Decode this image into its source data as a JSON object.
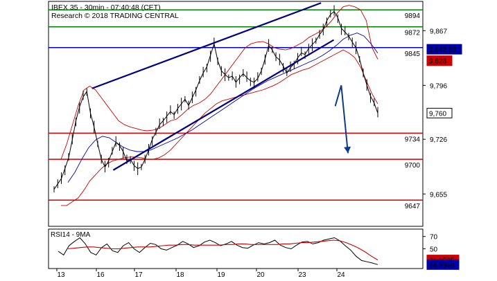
{
  "header": {
    "title": "IBEX 35 - 30min - 07:40:48 (CET)",
    "subtitle": "Research © 2018 TRADING CENTRAL"
  },
  "rsi": {
    "label": "RSI14 - 9MA"
  },
  "colors": {
    "price": "#000000",
    "bollinger": "#cc0000",
    "ma": "#0000aa",
    "trend": "#000080",
    "resistance_green": "#008000",
    "pivot_blue": "#0000cc",
    "support_red": "#cc0000",
    "projection": "#0a3a8a",
    "rsi": "#000000",
    "rsi_ma": "#cc0000",
    "rsi_value_box": "#cc0000",
    "rsi_ma_box": "#0000aa",
    "current_box": "#ffffff",
    "pivot_box": "#0000aa",
    "lower_box": "#cc0000"
  },
  "chart_data": [
    {
      "type": "line",
      "title": "IBEX 35 - 30min - 07:40:48 (CET)",
      "x_tick_labels": [
        "13",
        "16",
        "17",
        "18",
        "19",
        "20",
        "23",
        "24"
      ],
      "y_tick_labels": [
        "9,867",
        "9,796",
        "9,726",
        "9,655"
      ],
      "ylim": [
        9613,
        9905
      ],
      "grid": false,
      "close": [
        9661,
        9668,
        9675,
        9688,
        9702,
        9725,
        9750,
        9768,
        9781,
        9788,
        9760,
        9742,
        9720,
        9700,
        9690,
        9698,
        9710,
        9722,
        9718,
        9710,
        9698,
        9700,
        9692,
        9688,
        9690,
        9700,
        9712,
        9726,
        9735,
        9745,
        9750,
        9756,
        9762,
        9758,
        9766,
        9772,
        9778,
        9770,
        9780,
        9790,
        9802,
        9812,
        9820,
        9835,
        9850,
        9828,
        9815,
        9810,
        9806,
        9808,
        9800,
        9806,
        9811,
        9806,
        9802,
        9800,
        9805,
        9815,
        9830,
        9848,
        9842,
        9833,
        9829,
        9821,
        9812,
        9819,
        9824,
        9832,
        9838,
        9836,
        9844,
        9849,
        9854,
        9862,
        9868,
        9880,
        9888,
        9892,
        9884,
        9870,
        9865,
        9860,
        9852,
        9845,
        9830,
        9812,
        9796,
        9782,
        9773,
        9760
      ],
      "bollinger_upper": [
        9700,
        9720,
        9745,
        9770,
        9790,
        9795,
        9790,
        9780,
        9770,
        9760,
        9750,
        9745,
        9742,
        9740,
        9738,
        9737,
        9738,
        9740,
        9745,
        9750,
        9752,
        9758,
        9765,
        9770,
        9773,
        9778,
        9785,
        9795,
        9805,
        9815,
        9825,
        9835,
        9845,
        9850,
        9852,
        9853,
        9850,
        9845,
        9843,
        9842,
        9844,
        9848,
        9852,
        9858,
        9862,
        9866,
        9872,
        9880,
        9890,
        9898,
        9900,
        9898,
        9894,
        9880,
        9845,
        9830
      ],
      "bollinger_lower": [
        9640,
        9640,
        9645,
        9650,
        9660,
        9672,
        9680,
        9688,
        9694,
        9698,
        9700,
        9702,
        9703,
        9703,
        9702,
        9700,
        9700,
        9702,
        9706,
        9712,
        9720,
        9728,
        9736,
        9744,
        9752,
        9760,
        9766,
        9772,
        9776,
        9778,
        9780,
        9782,
        9784,
        9786,
        9788,
        9790,
        9793,
        9796,
        9800,
        9805,
        9810,
        9813,
        9816,
        9818,
        9822,
        9826,
        9830,
        9834,
        9838,
        9842,
        9838,
        9832,
        9820,
        9802,
        9785,
        9772
      ],
      "moving_average": [
        9670,
        9683,
        9700,
        9715,
        9725,
        9730,
        9728,
        9722,
        9716,
        9712,
        9710,
        9710,
        9712,
        9716,
        9720,
        9724,
        9728,
        9733,
        9738,
        9744,
        9750,
        9756,
        9762,
        9768,
        9774,
        9780,
        9786,
        9792,
        9797,
        9802,
        9806,
        9810,
        9814,
        9818,
        9822,
        9826,
        9830,
        9835,
        9841,
        9848,
        9856,
        9861,
        9864,
        9860,
        9850,
        9838
      ],
      "trendline_upper": [
        [
          0.116,
          9792
        ],
        [
          0.728,
          9903
        ]
      ],
      "trendline_lower": [
        [
          0.173,
          9686
        ],
        [
          0.762,
          9855
        ]
      ],
      "projection": [
        [
          0.766,
          9769
        ],
        [
          0.782,
          9796
        ],
        [
          0.8,
          9708
        ]
      ],
      "horizontal_levels": [
        {
          "label": "9894",
          "value": 9894
        },
        {
          "label": "9872",
          "value": 9872
        },
        {
          "label": "9845",
          "value": 9845
        },
        {
          "label": "9734",
          "value": 9734
        },
        {
          "label": "9700",
          "value": 9700
        },
        {
          "label": "9647",
          "value": 9647
        }
      ],
      "value_boxes": [
        {
          "label": "9,842.88",
          "value": 9842.88
        },
        {
          "label": "9,828",
          "value": 9828
        },
        {
          "label": "9,760",
          "value": 9760
        }
      ]
    },
    {
      "type": "line",
      "title": "RSI14 - 9MA",
      "x_tick_labels": [
        "13",
        "16",
        "17",
        "18",
        "19",
        "20",
        "23",
        "24"
      ],
      "y_tick_labels": [
        "70",
        "50"
      ],
      "ylim": [
        18,
        82
      ],
      "grid": false,
      "series": [
        {
          "name": "RSI14",
          "values": [
            46,
            40,
            55,
            62,
            68,
            58,
            44,
            40,
            52,
            58,
            47,
            44,
            55,
            60,
            50,
            44,
            52,
            59,
            57,
            50,
            48,
            52,
            56,
            62,
            58,
            52,
            55,
            61,
            64,
            60,
            55,
            58,
            62,
            56,
            52,
            51,
            56,
            60,
            58,
            60,
            64,
            56,
            52,
            50,
            56,
            61,
            62,
            58,
            60,
            64,
            66,
            68,
            63,
            55,
            48,
            38,
            31,
            29,
            27,
            24.38
          ]
        },
        {
          "name": "9MA",
          "values": [
            50,
            51,
            52,
            53,
            53,
            52,
            51,
            50,
            50,
            51,
            52,
            53,
            53,
            53,
            54,
            55,
            56,
            56,
            57,
            57,
            56,
            56,
            56,
            56,
            56,
            57,
            57,
            58,
            58,
            57,
            57,
            57,
            57,
            57,
            58,
            58,
            59,
            60,
            60,
            61,
            62,
            63,
            64,
            63,
            60,
            56,
            51,
            45,
            38,
            31.95
          ]
        }
      ],
      "value_boxes": [
        {
          "label": "31.9525",
          "value": 31.9525
        },
        {
          "label": "24.3849",
          "value": 24.3849
        }
      ]
    }
  ]
}
